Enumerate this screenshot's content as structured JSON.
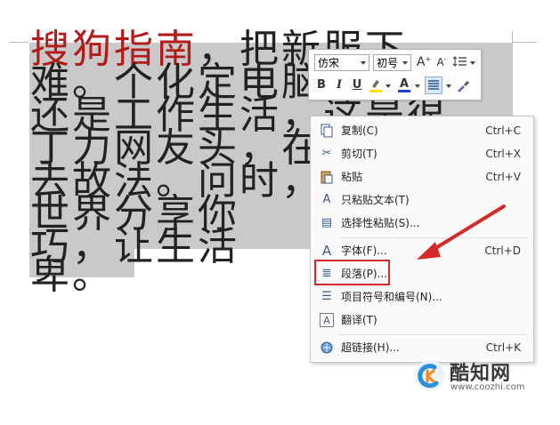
{
  "document": {
    "lines": [
      {
        "red": "搜狗指南",
        "text": "，把新服下"
      },
      {
        "red": "",
        "text": "难。个化定电脑，"
      },
      {
        "red": "",
        "text": "还是工作生活，这是很"
      },
      {
        "red": "",
        "text": "丁力网友头，在"
      },
      {
        "red": "",
        "text": "去故法。问时，"
      },
      {
        "red": "",
        "text": "世界分享你"
      },
      {
        "red": "",
        "text": "巧，让生活"
      },
      {
        "red": "",
        "text": "卑。"
      }
    ]
  },
  "mini_toolbar": {
    "font_name": "仿宋",
    "font_size": "初号",
    "grow_font": "A",
    "shrink_font": "A",
    "bold": "B",
    "italic": "I",
    "underline": "U",
    "font_color": "A"
  },
  "context_menu": {
    "items": [
      {
        "label": "复制(C)",
        "shortcut": "Ctrl+C",
        "icon": "copy-icon",
        "glyph": "⧉"
      },
      {
        "label": "剪切(T)",
        "shortcut": "Ctrl+X",
        "icon": "scissors-icon",
        "glyph": "✂"
      },
      {
        "label": "粘贴",
        "shortcut": "Ctrl+V",
        "icon": "paste-icon",
        "glyph": "📋"
      },
      {
        "label": "只粘贴文本(T)",
        "shortcut": "",
        "icon": "paste-text-icon",
        "glyph": "A"
      },
      {
        "label": "选择性粘贴(S)...",
        "shortcut": "",
        "icon": "paste-special-icon",
        "glyph": "▤"
      },
      {
        "label": "字体(F)...",
        "shortcut": "Ctrl+D",
        "icon": "font-icon",
        "glyph": "A"
      },
      {
        "label": "段落(P)...",
        "shortcut": "",
        "icon": "paragraph-icon",
        "glyph": "≣"
      },
      {
        "label": "项目符号和编号(N)...",
        "shortcut": "",
        "icon": "bullets-icon",
        "glyph": "☰"
      },
      {
        "label": "翻译(T)",
        "shortcut": "",
        "icon": "translate-icon",
        "glyph": "A"
      },
      {
        "label": "超链接(H)...",
        "shortcut": "Ctrl+K",
        "icon": "hyperlink-icon",
        "glyph": "🔗"
      }
    ]
  },
  "watermark": {
    "title": "酷知网",
    "url": "www.coozhi.com"
  },
  "colors": {
    "selection": "#c9c9c9",
    "highlight_box": "#d42a2a",
    "arrow": "#d42a2a",
    "red_text": "#b31b1b",
    "font_color_bar": "#1d3fd1",
    "highlight_color_bar": "#f5e500"
  }
}
